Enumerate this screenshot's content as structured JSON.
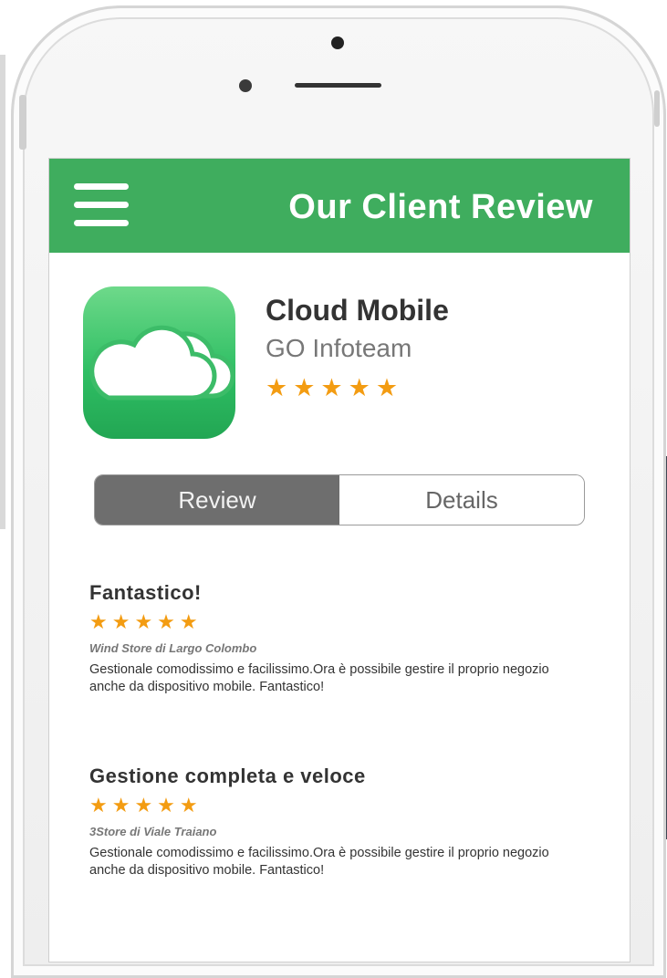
{
  "header": {
    "title": "Our Client Review",
    "accent_color": "#3fad5e",
    "menu_icon": "hamburger-menu-icon"
  },
  "app": {
    "name": "Cloud Mobile",
    "developer": "GO Infoteam",
    "rating_stars": "★★★★★",
    "rating": 5,
    "icon": "cloud-icon"
  },
  "tabs": [
    {
      "label": "Review",
      "active": true
    },
    {
      "label": "Details",
      "active": false
    }
  ],
  "reviews": [
    {
      "title": "Fantastico!",
      "stars": "★★★★★",
      "rating": 5,
      "author": "Wind Store di Largo Colombo",
      "body": "Gestionale comodissimo e facilissimo.Ora è possibile gestire il proprio negozio anche da dispositivo mobile. Fantastico!"
    },
    {
      "title": "Gestione completa e veloce",
      "stars": "★★★★★",
      "rating": 5,
      "author": "3Store di Viale Traiano",
      "body": "Gestionale comodissimo e facilissimo.Ora è possibile gestire il proprio negozio anche da dispositivo mobile. Fantastico!"
    }
  ],
  "colors": {
    "star": "#f39c12",
    "tab_active": "#6e6e6e"
  }
}
